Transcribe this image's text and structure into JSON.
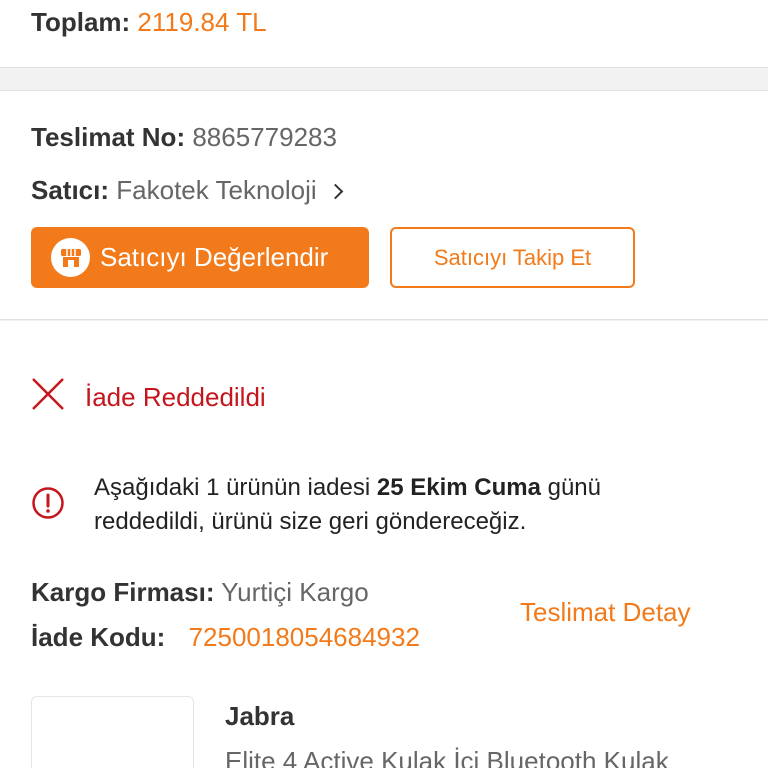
{
  "order": {
    "total_label": "Toplam:",
    "total_value": "2119.84 TL"
  },
  "delivery": {
    "no_label": "Teslimat No:",
    "no_value": "8865779283",
    "seller_label": "Satıcı:",
    "seller_name": "Fakotek Teknoloji",
    "rate_button": "Satıcıyı Değerlendir",
    "follow_button": "Satıcıyı Takip Et"
  },
  "return_info": {
    "status": "İade Reddedildi",
    "message_pre": "Aşağıdaki 1 ürünün iadesi ",
    "message_bold": "25 Ekim Cuma",
    "message_post": " günü reddedildi, ürünü size geri göndereceğiz.",
    "carrier_label": "Kargo Firması:",
    "carrier_value": "Yurtiçi Kargo",
    "code_label": "İade Kodu:",
    "code_value": "7250018054684932",
    "detail_link": "Teslimat Detay"
  },
  "product": {
    "brand": "Jabra",
    "name": "Elite 4 Active Kulak İçi Bluetooth Kulak"
  },
  "icons": {
    "store": "store-icon",
    "chevron": "chevron-right-icon",
    "rejected": "close-icon",
    "info": "info-icon"
  },
  "colors": {
    "accent": "#f27a1a",
    "error": "#c4161c"
  }
}
